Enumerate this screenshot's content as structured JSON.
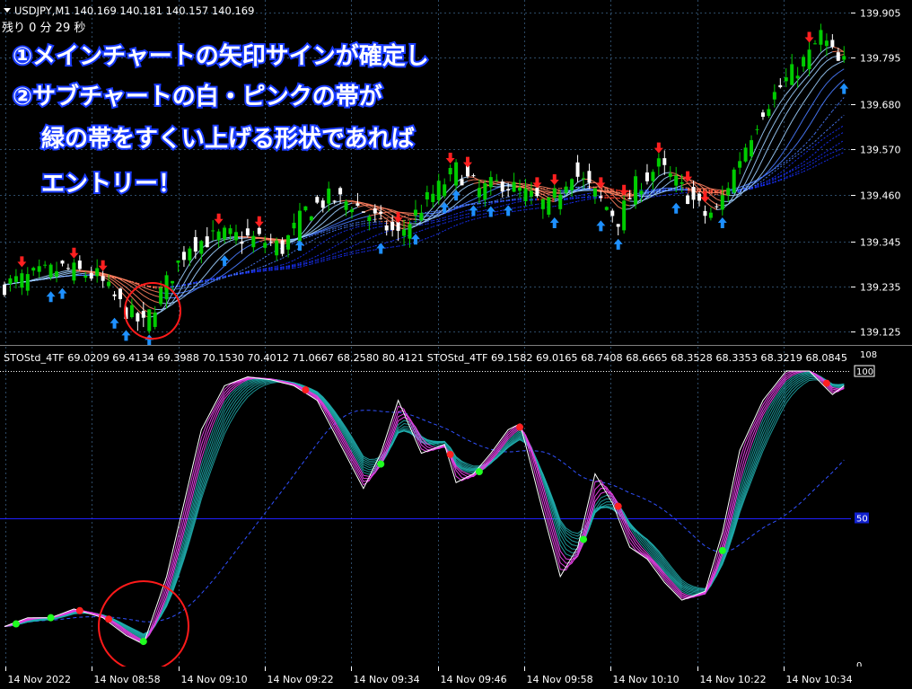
{
  "window": {
    "symbol_line": "USDJPY,M1  140.169 140.181 140.157 140.169",
    "timer": "残り  0  分  29  秒",
    "indicator_line": "STOStd_4TF 69.0209 69.4134 69.3988 70.1530 70.4012 71.0667 68.2580 80.4121  STOStd_4TF 69.1582 69.0165 68.7408 68.6665 68.3528 68.3353 68.3219 68.0845"
  },
  "annotations": {
    "line1": "①メインチャートの矢印サインが確定し",
    "line2": "②サブチャートの白・ピンクの帯が",
    "line3": "緑の帯をすくい上げる形状であれば",
    "line4": "エントリー！"
  },
  "colors": {
    "background": "#000000",
    "grid": "#2d4a66",
    "bull_candle": "#00cc00",
    "bear_candle": "#ffffff",
    "up_arrow": "#1e90ff",
    "down_arrow": "#ff2020",
    "highlight_circle": "#ff1a1a",
    "stoch_fast": "#ffffff",
    "stoch_pink": "#e040e0",
    "stoch_teal": "#20b0b0",
    "level_line": "#2020ff"
  },
  "chart_data": [
    {
      "type": "candlestick",
      "title": "USDJPY,M1",
      "y_ticks": [
        "139.905",
        "139.795",
        "139.680",
        "139.570",
        "139.460",
        "139.345",
        "139.235",
        "139.125"
      ],
      "ylim": [
        139.095,
        139.935
      ],
      "x_ticks": [
        "14 Nov 2022",
        "14 Nov 08:58",
        "14 Nov 09:10",
        "14 Nov 09:22",
        "14 Nov 09:34",
        "14 Nov 09:46",
        "14 Nov 09:58",
        "14 Nov 10:10",
        "14 Nov 10:22",
        "14 Nov 10:34"
      ],
      "close_path": [
        [
          0,
          139.24
        ],
        [
          10,
          139.28
        ],
        [
          16,
          139.26
        ],
        [
          20,
          139.19
        ],
        [
          24,
          139.14
        ],
        [
          27,
          139.22
        ],
        [
          32,
          139.34
        ],
        [
          38,
          139.36
        ],
        [
          44,
          139.35
        ],
        [
          48,
          139.33
        ],
        [
          52,
          139.42
        ],
        [
          56,
          139.45
        ],
        [
          60,
          139.44
        ],
        [
          64,
          139.4
        ],
        [
          68,
          139.36
        ],
        [
          72,
          139.43
        ],
        [
          78,
          139.52
        ],
        [
          82,
          139.47
        ],
        [
          86,
          139.49
        ],
        [
          90,
          139.46
        ],
        [
          94,
          139.43
        ],
        [
          98,
          139.52
        ],
        [
          102,
          139.46
        ],
        [
          106,
          139.4
        ],
        [
          109,
          139.48
        ],
        [
          113,
          139.53
        ],
        [
          118,
          139.46
        ],
        [
          121,
          139.41
        ],
        [
          123,
          139.42
        ],
        [
          127,
          139.55
        ],
        [
          131,
          139.67
        ],
        [
          135,
          139.74
        ],
        [
          139,
          139.8
        ],
        [
          141,
          139.85
        ],
        [
          144,
          139.78
        ]
      ],
      "up_arrow_bars": [
        8,
        10,
        19,
        21,
        25,
        38,
        51,
        65,
        71,
        76,
        78,
        81,
        84,
        87,
        95,
        103,
        106,
        116,
        124,
        145
      ],
      "down_arrow_bars": [
        3,
        12,
        17,
        37,
        44,
        68,
        77,
        80,
        92,
        95,
        103,
        107,
        113,
        118,
        121,
        139
      ]
    },
    {
      "type": "line",
      "title": "STOStd_4TF",
      "ylim": [
        0,
        100
      ],
      "y_ticks": [
        "100",
        "50",
        "0"
      ],
      "levels": [
        100,
        50
      ],
      "path": [
        [
          0,
          13
        ],
        [
          4,
          16
        ],
        [
          8,
          16
        ],
        [
          12,
          19
        ],
        [
          17,
          16
        ],
        [
          21,
          10
        ],
        [
          24,
          7
        ],
        [
          28,
          30
        ],
        [
          31,
          55
        ],
        [
          34,
          80
        ],
        [
          38,
          95
        ],
        [
          42,
          98
        ],
        [
          46,
          97
        ],
        [
          50,
          95
        ],
        [
          54,
          90
        ],
        [
          58,
          75
        ],
        [
          62,
          60
        ],
        [
          65,
          72
        ],
        [
          68,
          90
        ],
        [
          72,
          72
        ],
        [
          76,
          75
        ],
        [
          78,
          62
        ],
        [
          81,
          65
        ],
        [
          84,
          72
        ],
        [
          87,
          80
        ],
        [
          89,
          82
        ],
        [
          90,
          75
        ],
        [
          93,
          52
        ],
        [
          96,
          30
        ],
        [
          99,
          40
        ],
        [
          102,
          65
        ],
        [
          105,
          55
        ],
        [
          108,
          40
        ],
        [
          111,
          36
        ],
        [
          114,
          28
        ],
        [
          117,
          22
        ],
        [
          121,
          25
        ],
        [
          124,
          45
        ],
        [
          127,
          73
        ],
        [
          131,
          90
        ],
        [
          135,
          100
        ],
        [
          139,
          100
        ],
        [
          143,
          92
        ],
        [
          145,
          95
        ]
      ],
      "signal_points": [
        {
          "bar": 2,
          "color": "green"
        },
        {
          "bar": 8,
          "color": "green"
        },
        {
          "bar": 13,
          "color": "red"
        },
        {
          "bar": 18,
          "color": "red"
        },
        {
          "bar": 24,
          "color": "green"
        },
        {
          "bar": 52,
          "color": "red"
        },
        {
          "bar": 65,
          "color": "green"
        },
        {
          "bar": 77,
          "color": "red"
        },
        {
          "bar": 82,
          "color": "green"
        },
        {
          "bar": 89,
          "color": "red"
        },
        {
          "bar": 100,
          "color": "green"
        },
        {
          "bar": 106,
          "color": "red"
        },
        {
          "bar": 124,
          "color": "green"
        },
        {
          "bar": 142,
          "color": "red"
        }
      ]
    }
  ]
}
